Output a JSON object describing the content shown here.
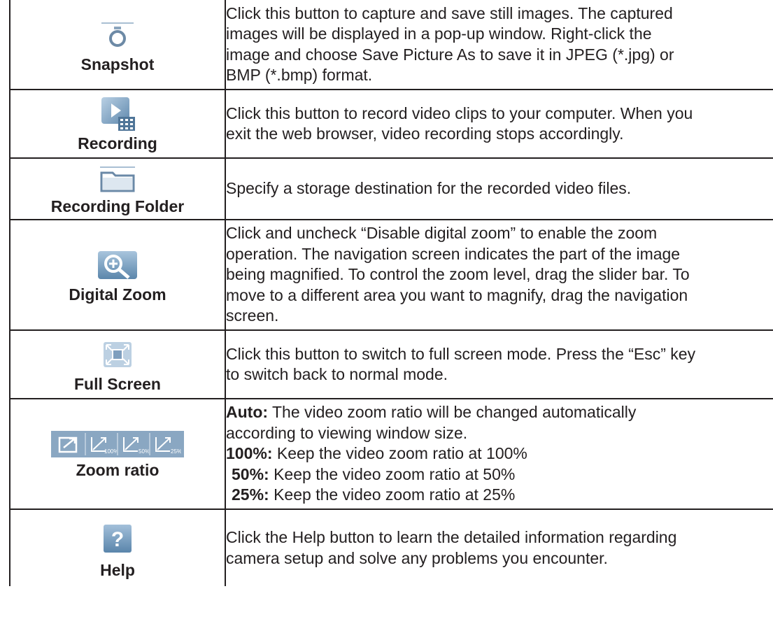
{
  "rows": [
    {
      "icon": "snapshot-icon",
      "label": "Snapshot",
      "lines": [
        "Click this button to capture and save still images. The captured",
        "images will be displayed in a pop-up window. Right-click the",
        "image and choose Save Picture As to save it in JPEG (*.jpg) or",
        "BMP (*.bmp) format."
      ]
    },
    {
      "icon": "recording-icon",
      "label": "Recording",
      "lines": [
        "Click this button to record video clips to your computer. When you",
        "exit the web browser, video recording stops accordingly."
      ]
    },
    {
      "icon": "folder-icon",
      "label": "Recording Folder",
      "lines": [
        "Specify a storage destination for the recorded video files."
      ]
    },
    {
      "icon": "magnifier-icon",
      "label": "Digital Zoom",
      "lines": [
        "Click and uncheck “Disable digital zoom” to enable the zoom",
        "operation. The navigation screen indicates the part of the image",
        "being magnified. To control the zoom level, drag the slider bar. To",
        "move to a different area you want to magnify, drag the navigation",
        "screen."
      ]
    },
    {
      "icon": "full-screen-icon",
      "label": "Full Screen",
      "lines": [
        "Click this button to switch to full screen mode. Press the “Esc” key",
        "to switch back to normal mode."
      ]
    },
    {
      "icon": "zoom-ratio-icons",
      "label": "Zoom ratio",
      "zoom_buttons": [
        "auto",
        "100%",
        "50%",
        "25%"
      ],
      "items": [
        {
          "term": "Auto:",
          "text": " The video zoom ratio will be changed automatically"
        },
        {
          "term": "",
          "text": "according to viewing window size."
        },
        {
          "term": "100%:",
          "text": " Keep the video zoom ratio at 100%"
        },
        {
          "term": "50%:",
          "text": " Keep the video zoom ratio at 50%"
        },
        {
          "term": "25%:",
          "text": " Keep the video zoom ratio at 25%"
        }
      ]
    },
    {
      "icon": "help-icon",
      "label": "Help",
      "glyph": "?",
      "lines": [
        "Click the Help button to learn the detailed information regarding",
        "camera setup and solve any problems you encounter."
      ]
    }
  ]
}
